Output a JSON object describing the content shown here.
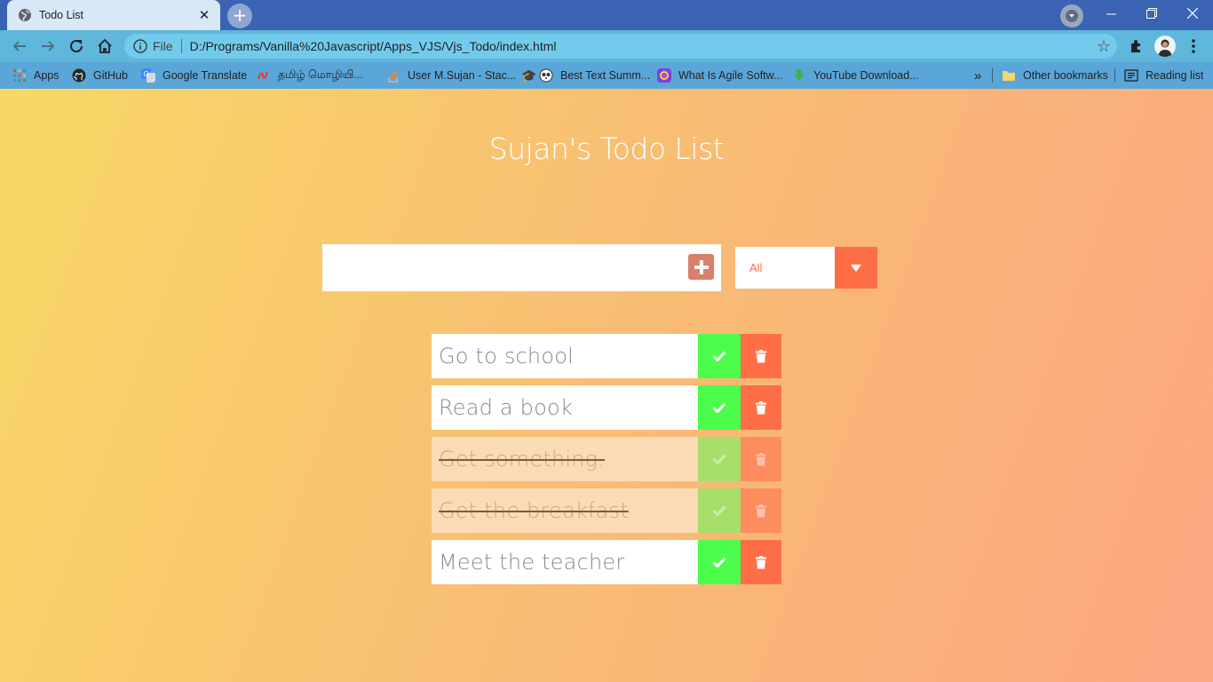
{
  "browser": {
    "tab_title": "Todo List",
    "scheme_label": "File",
    "url": "D:/Programs/Vanilla%20Javascript/Apps_VJS/Vjs_Todo/index.html",
    "bookmarks": [
      {
        "label": "Apps",
        "icon": "apps-grid-icon",
        "color": "#e8453c"
      },
      {
        "label": "GitHub",
        "icon": "github-icon",
        "color": "#24292e"
      },
      {
        "label": "Google Translate",
        "icon": "google-translate-icon",
        "color": "#4285f4"
      },
      {
        "label": "தமிழ் மொழியி...",
        "icon": "tamil-site-icon",
        "color": "#e53935"
      },
      {
        "label": "User M.Sujan - Stac...",
        "icon": "stackoverflow-icon",
        "color": "#f48024"
      },
      {
        "label": "Best Text Summ...",
        "icon": "text-summarizer-icon",
        "color": "#333333"
      },
      {
        "label": "What Is Agile Softw...",
        "icon": "agile-site-icon",
        "color": "#7b3fe4"
      },
      {
        "label": "YouTube Download...",
        "icon": "youtube-download-icon",
        "color": "#3bb54a"
      }
    ],
    "more_label": "»",
    "other_bookmarks": "Other bookmarks",
    "reading_list": "Reading list"
  },
  "app": {
    "title": "Sujan's Todo List",
    "input_value": "",
    "filter_selected": "All",
    "todos": [
      {
        "text": "Go to school",
        "completed": false
      },
      {
        "text": "Read a book",
        "completed": false
      },
      {
        "text": "Get something.",
        "completed": true
      },
      {
        "text": "Get the breakfast",
        "completed": true
      },
      {
        "text": "Meet the teacher",
        "completed": false
      }
    ]
  },
  "colors": {
    "accent": "#ff6f47",
    "check": "#4cfd4c",
    "gradient_start": "#f8d865",
    "gradient_end": "#fca682"
  }
}
